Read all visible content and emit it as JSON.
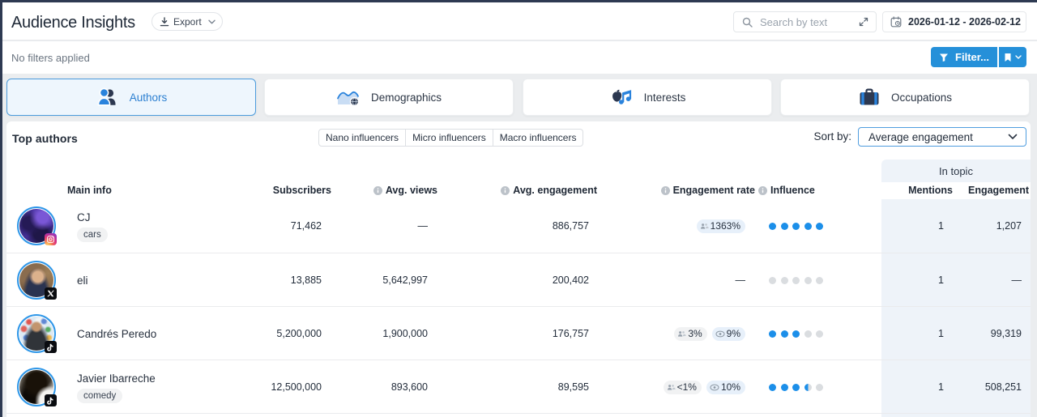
{
  "header": {
    "title": "Audience Insights",
    "export_label": "Export",
    "search_placeholder": "Search by text",
    "date_range": "2026-01-12 - 2026-02-12"
  },
  "filter_bar": {
    "status": "No filters applied",
    "filter_label": "Filter..."
  },
  "tabs": [
    {
      "label": "Authors",
      "selected": true
    },
    {
      "label": "Demographics",
      "selected": false
    },
    {
      "label": "Interests",
      "selected": false
    },
    {
      "label": "Occupations",
      "selected": false
    }
  ],
  "section": {
    "title": "Top authors",
    "influencer_filters": [
      "Nano influencers",
      "Micro influencers",
      "Macro influencers"
    ],
    "sort_label": "Sort by:",
    "sort_value": "Average engagement"
  },
  "table": {
    "group_header": "In topic",
    "columns": {
      "main_info": "Main info",
      "subscribers": "Subscribers",
      "avg_views": "Avg. views",
      "avg_engagement": "Avg. engagement",
      "engagement_rate": "Engagement rate",
      "influence": "Influence",
      "mentions": "Mentions",
      "engagement": "Engagement"
    },
    "rows": [
      {
        "name": "CJ",
        "tag": "cars",
        "platform": "instagram",
        "subscribers": "71,462",
        "avg_views": "—",
        "avg_engagement": "886,757",
        "rate_chips": [
          {
            "icon": "followers",
            "tone": "blue",
            "value": "1363%"
          }
        ],
        "influence": 5,
        "mentions": "1",
        "engagement": "1,207"
      },
      {
        "name": "eli",
        "tag": "",
        "platform": "x",
        "subscribers": "13,885",
        "avg_views": "5,642,997",
        "avg_engagement": "200,402",
        "rate_dash": "—",
        "rate_chips": [],
        "influence": 0,
        "mentions": "1",
        "engagement": "—"
      },
      {
        "name": "Candrés Peredo",
        "tag": "",
        "platform": "tiktok",
        "subscribers": "5,200,000",
        "avg_views": "1,900,000",
        "avg_engagement": "176,757",
        "rate_chips": [
          {
            "icon": "followers",
            "tone": "grey",
            "value": "3%"
          },
          {
            "icon": "views",
            "tone": "blue",
            "value": "9%"
          }
        ],
        "influence": 3,
        "mentions": "1",
        "engagement": "99,319"
      },
      {
        "name": "Javier Ibarreche",
        "tag": "comedy",
        "platform": "tiktok",
        "subscribers": "12,500,000",
        "avg_views": "893,600",
        "avg_engagement": "89,595",
        "rate_chips": [
          {
            "icon": "followers",
            "tone": "grey",
            "value": "<1%"
          },
          {
            "icon": "views",
            "tone": "blue",
            "value": "10%"
          }
        ],
        "influence": 3.5,
        "mentions": "1",
        "engagement": "508,251"
      }
    ]
  }
}
